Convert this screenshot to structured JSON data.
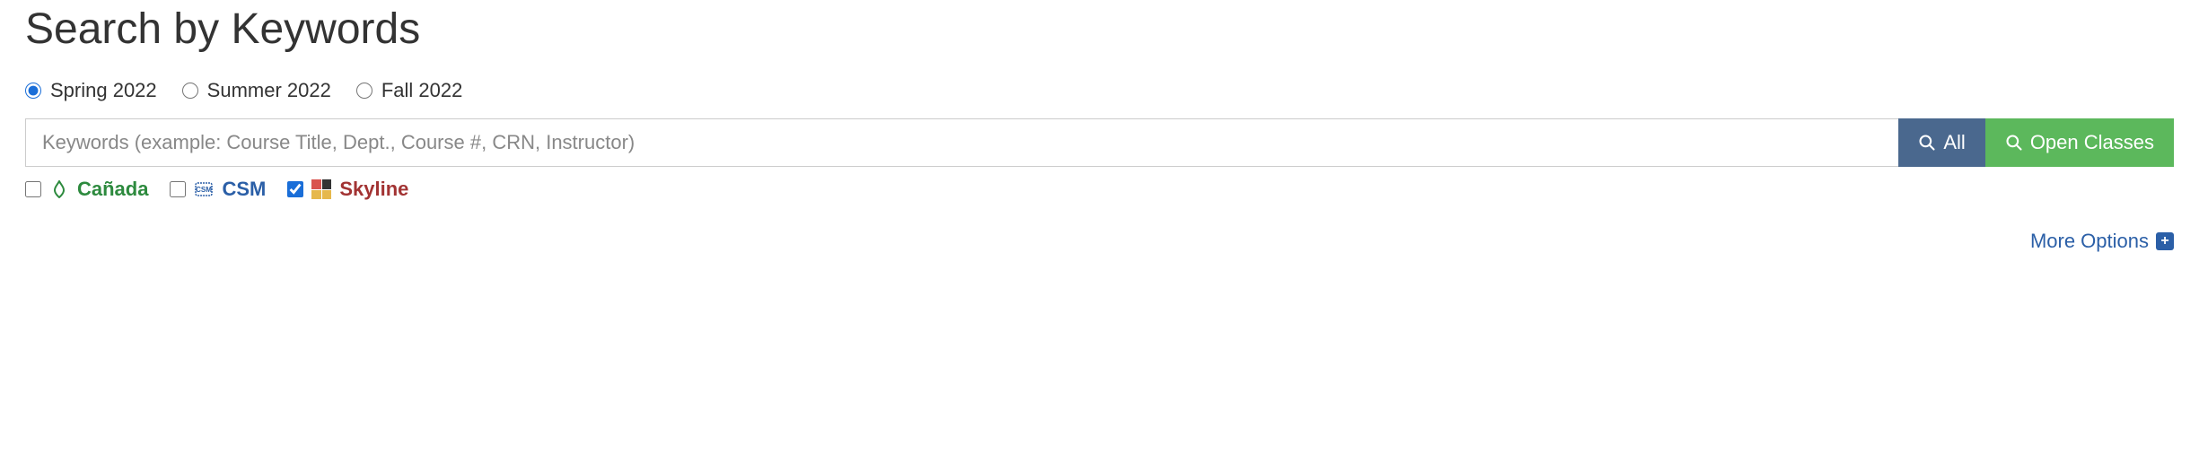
{
  "title": "Search by Keywords",
  "terms": {
    "options": [
      {
        "name": "spring-2022",
        "label": "Spring 2022",
        "checked": true
      },
      {
        "name": "summer-2022",
        "label": "Summer 2022",
        "checked": false
      },
      {
        "name": "fall-2022",
        "label": "Fall 2022",
        "checked": false
      }
    ]
  },
  "search": {
    "placeholder": "Keywords (example: Course Title, Dept., Course #, CRN, Instructor)",
    "value": "",
    "all_label": "All",
    "open_label": "Open Classes"
  },
  "colleges": {
    "options": [
      {
        "name": "canada",
        "label": "Cañada",
        "checked": false
      },
      {
        "name": "csm",
        "label": "CSM",
        "checked": false
      },
      {
        "name": "skyline",
        "label": "Skyline",
        "checked": true
      }
    ]
  },
  "footer": {
    "more_options": "More Options"
  }
}
